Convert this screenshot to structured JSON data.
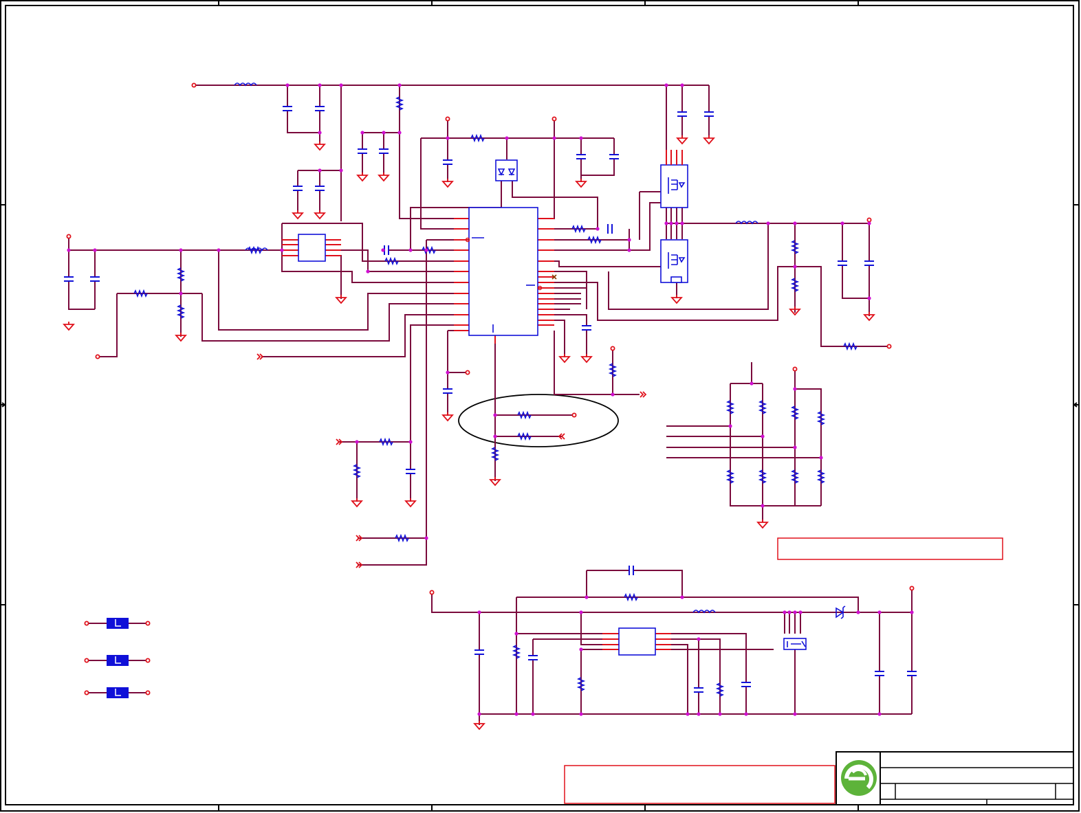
{
  "sheet": {
    "title_text": "",
    "note_texts": [
      "",
      ""
    ]
  },
  "colors": {
    "wire": "#7a0a3c",
    "pin": "#e0101a",
    "component": "#1010d8",
    "junction": "#d010d0",
    "frame": "#000000",
    "logo_green": "#5db33a"
  },
  "icons": {
    "logo": "company-logo-icon",
    "ground": "ground-icon",
    "port_arrow": "port-arrow-icon",
    "no_connect": "no-connect-icon"
  }
}
